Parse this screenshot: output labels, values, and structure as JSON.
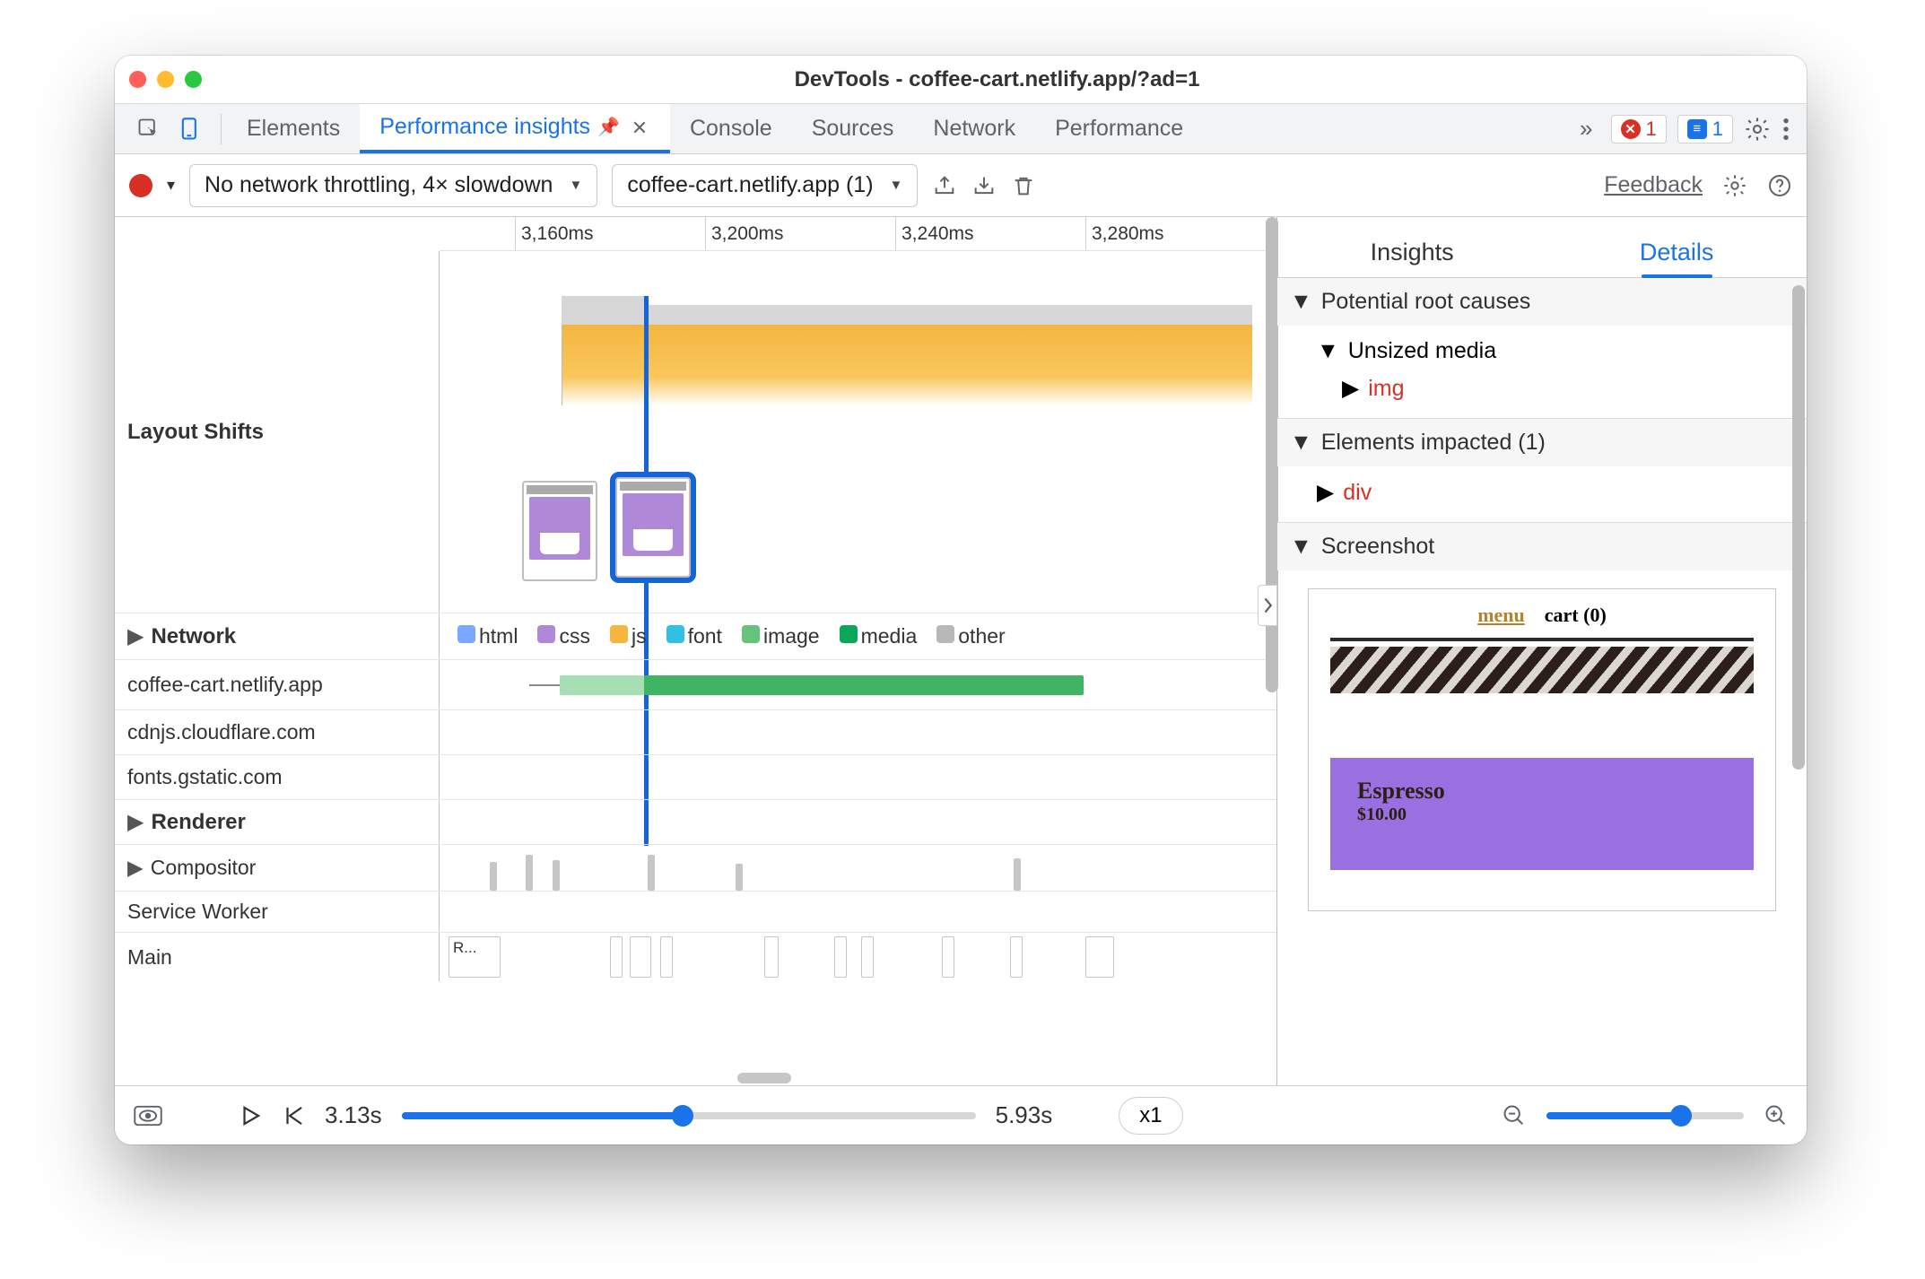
{
  "titlebar": {
    "title": "DevTools - coffee-cart.netlify.app/?ad=1"
  },
  "tabs": {
    "items": [
      "Elements",
      "Performance insights",
      "Console",
      "Sources",
      "Network",
      "Performance"
    ],
    "active_index": 1,
    "errors_count": "1",
    "messages_count": "1"
  },
  "toolbar": {
    "throttle": "No network throttling, 4× slowdown",
    "target": "coffee-cart.netlify.app (1)",
    "feedback": "Feedback"
  },
  "timeline": {
    "ticks": [
      "3,160ms",
      "3,200ms",
      "3,240ms",
      "3,280ms"
    ],
    "rails": {
      "layout_shifts": "Layout Shifts",
      "network": "Network",
      "renderer": "Renderer",
      "compositor": "Compositor",
      "service_worker": "Service Worker",
      "main": "Main"
    },
    "legend": {
      "html": {
        "label": "html",
        "color": "#7aa7ff"
      },
      "css": {
        "label": "css",
        "color": "#b088d8"
      },
      "js": {
        "label": "js",
        "color": "#f4b63f"
      },
      "font": {
        "label": "font",
        "color": "#30c0e3"
      },
      "image": {
        "label": "image",
        "color": "#64c47c"
      },
      "media": {
        "label": "media",
        "color": "#0aa65a"
      },
      "other": {
        "label": "other",
        "color": "#b8b8b8"
      }
    },
    "network_hosts": [
      "coffee-cart.netlify.app",
      "cdnjs.cloudflare.com",
      "fonts.gstatic.com"
    ],
    "main_first_block": "R..."
  },
  "details": {
    "tabs": {
      "insights": "Insights",
      "details": "Details"
    },
    "root_causes_header": "Potential root causes",
    "unsized_media": "Unsized media",
    "unsized_media_child": "img",
    "elements_impacted_header": "Elements impacted (1)",
    "elements_impacted_child": "div",
    "screenshot_header": "Screenshot",
    "screenshot": {
      "menu": "menu",
      "cart": "cart (0)",
      "product": "Espresso",
      "price": "$10.00"
    }
  },
  "bottombar": {
    "start": "3.13s",
    "end": "5.93s",
    "speed": "x1"
  }
}
